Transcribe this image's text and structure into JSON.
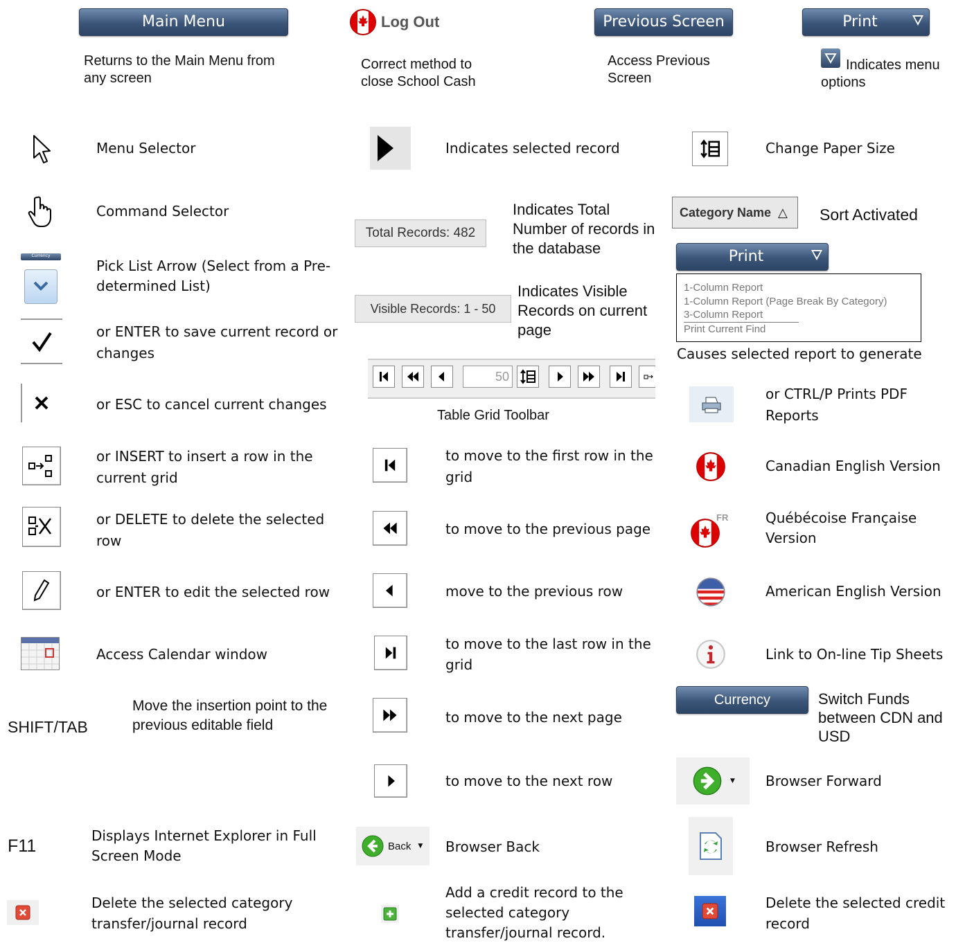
{
  "top_row": {
    "main_menu": {
      "label": "Main Menu",
      "caption": "Returns to the Main  Menu from any screen"
    },
    "log_out": {
      "label": "Log Out",
      "caption": "Correct method to close School Cash"
    },
    "previous_screen": {
      "label": "Previous Screen",
      "caption": "Access Previous Screen"
    },
    "print": {
      "label": "Print",
      "caption": "Indicates menu options"
    }
  },
  "left_col": [
    {
      "icon": "arrow-cursor-icon",
      "text": "Menu Selector"
    },
    {
      "icon": "hand-cursor-icon",
      "text": "Command Selector"
    },
    {
      "icon": "pick-list-arrow-icon",
      "text": "Pick List Arrow (Select from a Pre-determined List)",
      "mini_label": "Currency"
    },
    {
      "icon": "checkmark-icon",
      "text": "or ENTER to save current record or changes"
    },
    {
      "icon": "x-cancel-icon",
      "text": "or ESC to cancel current changes"
    },
    {
      "icon": "insert-row-icon",
      "text": "or INSERT to insert a row in the current grid"
    },
    {
      "icon": "delete-row-icon",
      "text": "or DELETE to delete the selected row"
    },
    {
      "icon": "pencil-edit-icon",
      "text": "or ENTER to edit the selected row"
    },
    {
      "icon": "calendar-icon",
      "text": "Access Calendar window"
    },
    {
      "key": "SHIFT/TAB",
      "text": "Move the insertion point to the previous editable field"
    },
    {
      "key": "F11",
      "text": "Displays Internet Explorer in Full Screen Mode"
    },
    {
      "icon": "red-x-icon",
      "text": "Delete the selected category transfer/journal record"
    }
  ],
  "mid_col": {
    "selected_record": "Indicates selected record",
    "total_records": {
      "label": "Total Records: 482",
      "text": "Indicates Total Number of records in the database"
    },
    "visible_records": {
      "label": "Visible Records: 1 - 50",
      "text": "Indicates Visible Records on current page"
    },
    "toolbar": {
      "page_value": "50",
      "caption": "Table Grid Toolbar"
    },
    "rows": [
      {
        "icon": "first-row-icon",
        "text": "to move to the first row in the grid"
      },
      {
        "icon": "previous-page-icon",
        "text": "to move to the previous page"
      },
      {
        "icon": "previous-row-icon",
        "text": "move to the previous row"
      },
      {
        "icon": "last-row-icon",
        "text": "to move to the last row in the grid"
      },
      {
        "icon": "next-page-icon",
        "text": "to move to the next page"
      },
      {
        "icon": "next-row-icon",
        "text": "to move to the next row"
      }
    ],
    "browser_back": {
      "label": "Back",
      "text": "Browser Back"
    },
    "add_credit": "Add a credit record to the selected category transfer/journal record."
  },
  "right_col": {
    "paper_size": "Change Paper Size",
    "sort": {
      "label": "Category Name",
      "text": "Sort Activated"
    },
    "print_menu": {
      "label": "Print",
      "options": [
        "1-Column Report",
        "1-Column Report (Page Break By Category)",
        "3-Column Report",
        "Print Current Find"
      ],
      "caption": "Causes selected report to generate"
    },
    "rows": [
      {
        "icon": "printer-icon",
        "text": "or CTRL/P Prints PDF Reports"
      },
      {
        "icon": "canada-flag-icon",
        "text": "Canadian English Version"
      },
      {
        "icon": "canada-flag-fr-icon",
        "text": "Québécoise Française Version",
        "badge": "FR"
      },
      {
        "icon": "us-flag-icon",
        "text": "American English Version"
      },
      {
        "icon": "info-icon",
        "text": "Link to On-line Tip Sheets"
      }
    ],
    "currency": {
      "label": "Currency",
      "text": "Switch Funds between CDN and USD"
    },
    "browser_forward": "Browser Forward",
    "browser_refresh": "Browser Refresh",
    "delete_credit": "Delete the selected credit record"
  }
}
